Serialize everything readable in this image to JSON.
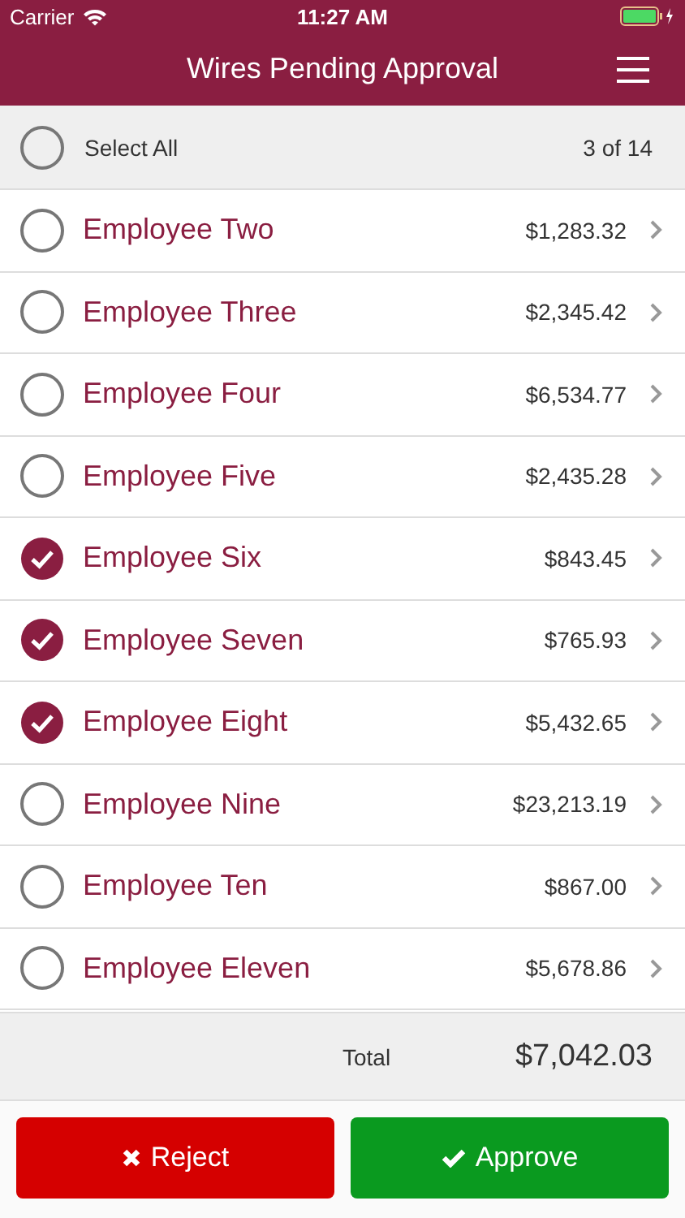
{
  "status_bar": {
    "carrier": "Carrier",
    "time": "11:27 AM"
  },
  "nav": {
    "title": "Wires Pending Approval"
  },
  "select_all": {
    "label": "Select All",
    "checked": false,
    "count": "3 of 14"
  },
  "employees": [
    {
      "name": "Employee Two",
      "amount": "$1,283.32",
      "selected": false
    },
    {
      "name": "Employee Three",
      "amount": "$2,345.42",
      "selected": false
    },
    {
      "name": "Employee Four",
      "amount": "$6,534.77",
      "selected": false
    },
    {
      "name": "Employee Five",
      "amount": "$2,435.28",
      "selected": false
    },
    {
      "name": "Employee Six",
      "amount": "$843.45",
      "selected": true
    },
    {
      "name": "Employee Seven",
      "amount": "$765.93",
      "selected": true
    },
    {
      "name": "Employee Eight",
      "amount": "$5,432.65",
      "selected": true
    },
    {
      "name": "Employee Nine",
      "amount": "$23,213.19",
      "selected": false
    },
    {
      "name": "Employee Ten",
      "amount": "$867.00",
      "selected": false
    },
    {
      "name": "Employee Eleven",
      "amount": "$5,678.86",
      "selected": false
    }
  ],
  "total": {
    "label": "Total",
    "amount": "$7,042.03"
  },
  "buttons": [
    {
      "label": "Reject",
      "kind": "reject"
    },
    {
      "label": "Approve",
      "kind": "approve"
    }
  ]
}
